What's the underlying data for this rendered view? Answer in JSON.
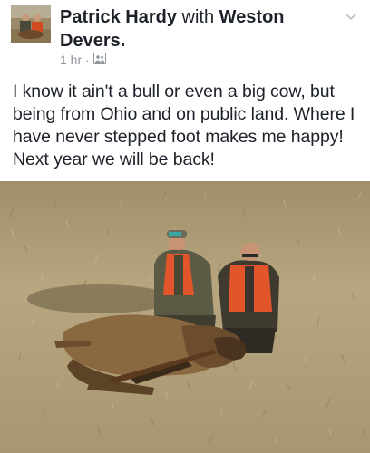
{
  "post": {
    "author": "Patrick Hardy",
    "with_text": "with",
    "tagged": "Weston Devers",
    "time": "1 hr",
    "separator": "·",
    "privacy_icon": "friends-list-icon",
    "menu_icon": "chevron-down-icon",
    "text": "I know it ain't a bull or even a big cow, but being from Ohio and on public land. Where I have never stepped foot makes me happy! Next year we will be back!"
  },
  "colors": {
    "text": "#1d2129",
    "meta": "#90949c",
    "grass": "#b5a27c"
  }
}
